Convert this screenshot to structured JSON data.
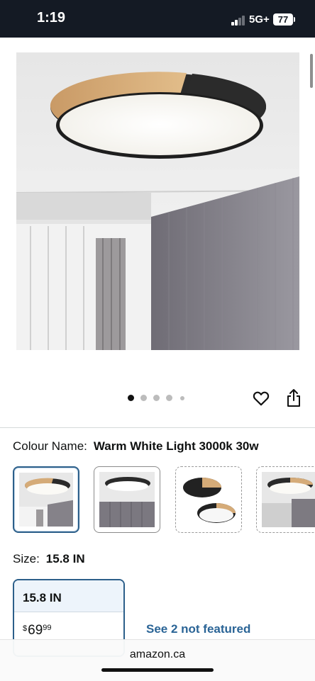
{
  "status_bar": {
    "time": "1:19",
    "network": "5G+",
    "battery": "77"
  },
  "gallery": {
    "image_count": 5,
    "active_index": 0,
    "image_icon": "ceiling-light-photo"
  },
  "actions": {
    "favorite_icon": "heart-icon",
    "share_icon": "share-icon"
  },
  "colour": {
    "label": "Colour Name:",
    "value": "Warm White Light 3000k 30w",
    "options_count": 4,
    "selected_index": 0
  },
  "size": {
    "label": "Size:",
    "value": "15.8 IN",
    "card": {
      "title": "15.8 IN",
      "currency": "$",
      "price_whole": "69",
      "price_fraction": "99"
    },
    "see_more": "See 2 not featured"
  },
  "browser": {
    "url": "amazon.ca"
  },
  "colors": {
    "accent": "#2c5f8a",
    "link": "#2a6496",
    "status_bar_bg": "#141a24"
  }
}
